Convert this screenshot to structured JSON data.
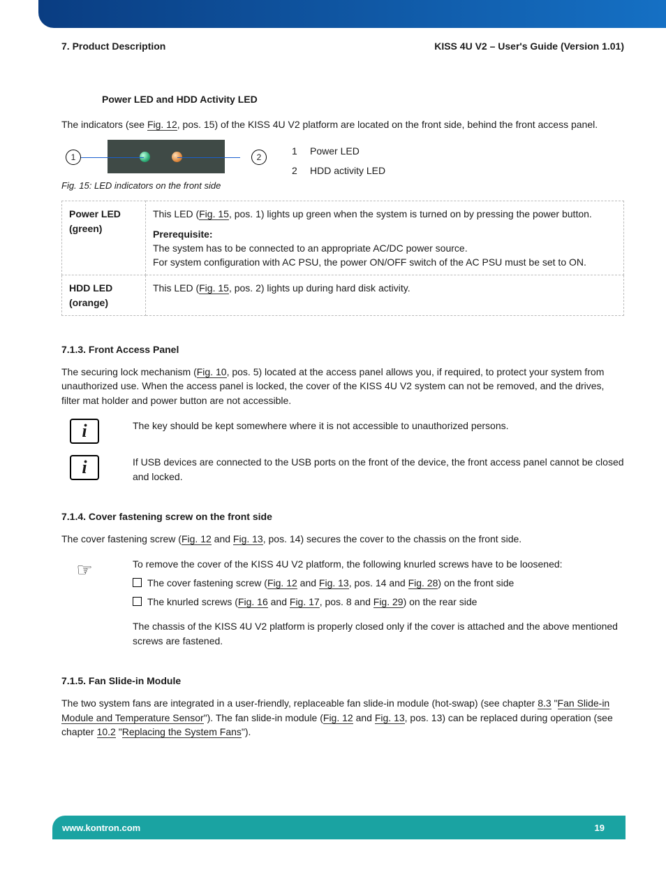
{
  "header": {
    "left": "7. Product Description",
    "right": "KISS 4U V2 – User's Guide (Version 1.01)"
  },
  "section_led": {
    "title": "Power LED and HDD Activity LED",
    "intro_a": "The indicators (see ",
    "intro_link": "Fig. 12",
    "intro_b": ", pos. 15) of the KISS 4U V2 platform are located on the front side, behind the front access panel.",
    "callout1": "1",
    "callout2": "2",
    "legend1_num": "1",
    "legend1_txt": "Power LED",
    "legend2_num": "2",
    "legend2_txt": "HDD activity LED",
    "fig_caption": "Fig. 15: LED indicators on the front side",
    "row1_label": "Power LED (green)",
    "row1_a": "This LED (",
    "row1_link": "Fig. 15",
    "row1_b": ", pos. 1) lights up green when the system is turned on by pressing the power button.",
    "row1_prereq_label": "Prerequisite:",
    "row1_prereq_1": "The system has to be connected to an appropriate AC/DC power source.",
    "row1_prereq_2": "For system configuration with AC PSU, the power ON/OFF switch of the AC PSU must be set to ON.",
    "row2_label": "HDD LED (orange)",
    "row2_a": "This LED (",
    "row2_link": "Fig. 15",
    "row2_b": ", pos. 2) lights up during hard disk activity."
  },
  "s713": {
    "title": "7.1.3. Front Access Panel",
    "p_a": "The securing lock mechanism (",
    "p_link": "Fig. 10",
    "p_b": ", pos. 5) located at the access panel allows you, if required, to protect your system from unauthorized use. When the access panel is locked, the cover of the KISS 4U V2 system can not be removed, and the drives, filter mat holder and power button are not accessible.",
    "note1": "The key should be kept somewhere where it is not accessible to unauthorized persons.",
    "note2": "If USB devices are connected to the USB ports on the front of the device, the front access panel cannot be closed and locked."
  },
  "s714": {
    "title": "7.1.4. Cover fastening screw on the front side",
    "p_a": "The cover fastening screw (",
    "p_link1": "Fig. 12",
    "p_mid1": " and ",
    "p_link2": "Fig. 13",
    "p_b": ", pos. 14) secures the cover to the chassis on the front side.",
    "hand_intro": "To remove the cover of the KISS 4U V2 platform, the following knurled screws have to be loosened:",
    "bullet1_a": "The cover fastening screw (",
    "bullet1_l1": "Fig. 12",
    "bullet1_mid": " and ",
    "bullet1_l2": "Fig. 13",
    "bullet1_b": ", pos. 14 and ",
    "bullet1_l3": "Fig. 28",
    "bullet1_c": ") on the front side",
    "bullet2_a": "The knurled screws (",
    "bullet2_l1": "Fig. 16",
    "bullet2_mid": " and ",
    "bullet2_l2": "Fig. 17",
    "bullet2_b": ", pos. 8 and ",
    "bullet2_l3": "Fig. 29",
    "bullet2_c": ") on the rear side",
    "after": "The chassis of the KISS 4U V2 platform is properly closed only if the cover is attached and the above mentioned screws are fastened."
  },
  "s715": {
    "title": "7.1.5. Fan Slide-in Module",
    "p_a": "The two system fans are integrated in a user-friendly, replaceable fan slide-in module (hot-swap) (see chapter ",
    "p_l1": "8.3",
    "p_mid1": " \"",
    "p_l2": "Fan Slide-in Module and Temperature Sensor",
    "p_mid2": "\"). The fan slide-in module (",
    "p_l3": "Fig. 12",
    "p_mid3": " and ",
    "p_l4": "Fig. 13",
    "p_mid4": ", pos. 13) can be replaced during operation (see chapter ",
    "p_l5": "10.2",
    "p_mid5": " \"",
    "p_l6": "Replacing the System Fans",
    "p_end": "\")."
  },
  "footer": {
    "url": "www.kontron.com",
    "page": "19"
  }
}
